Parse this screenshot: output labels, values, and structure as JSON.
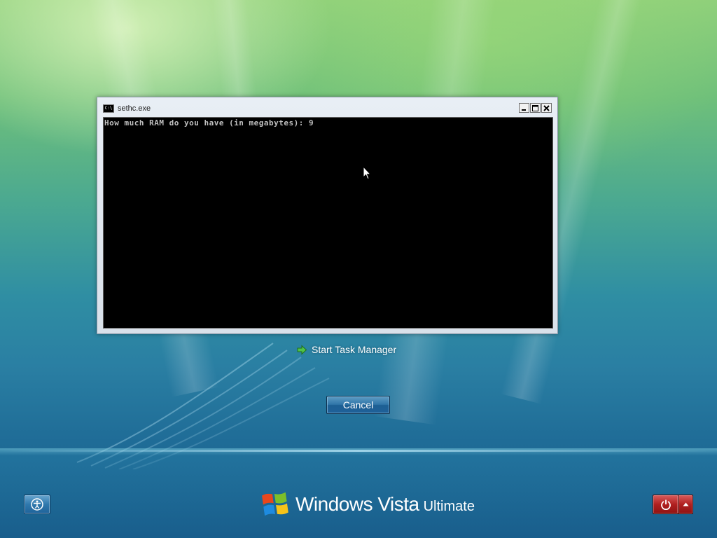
{
  "console": {
    "title": "sethc.exe",
    "icon": "console-icon",
    "icon_label": "C:\\",
    "buttons": {
      "minimize": "minimize-icon",
      "maximize": "maximize-icon",
      "close": "close-icon"
    },
    "text": "How much RAM do you have (in megabytes): 9"
  },
  "options": {
    "task_manager_label": "Start Task Manager",
    "task_manager_icon": "green-arrow-icon"
  },
  "cancel_label": "Cancel",
  "footer": {
    "ease_of_access_icon": "ease-of-access-icon",
    "logo_main": "Windows Vista",
    "logo_edition": "Ultimate",
    "power_icon": "power-icon",
    "power_menu_icon": "arrow-up-icon"
  },
  "colors": {
    "console_bg": "#000000",
    "console_text": "#c0c0c0",
    "cancel_button": "#2f75a8",
    "power_button": "#b02020"
  }
}
